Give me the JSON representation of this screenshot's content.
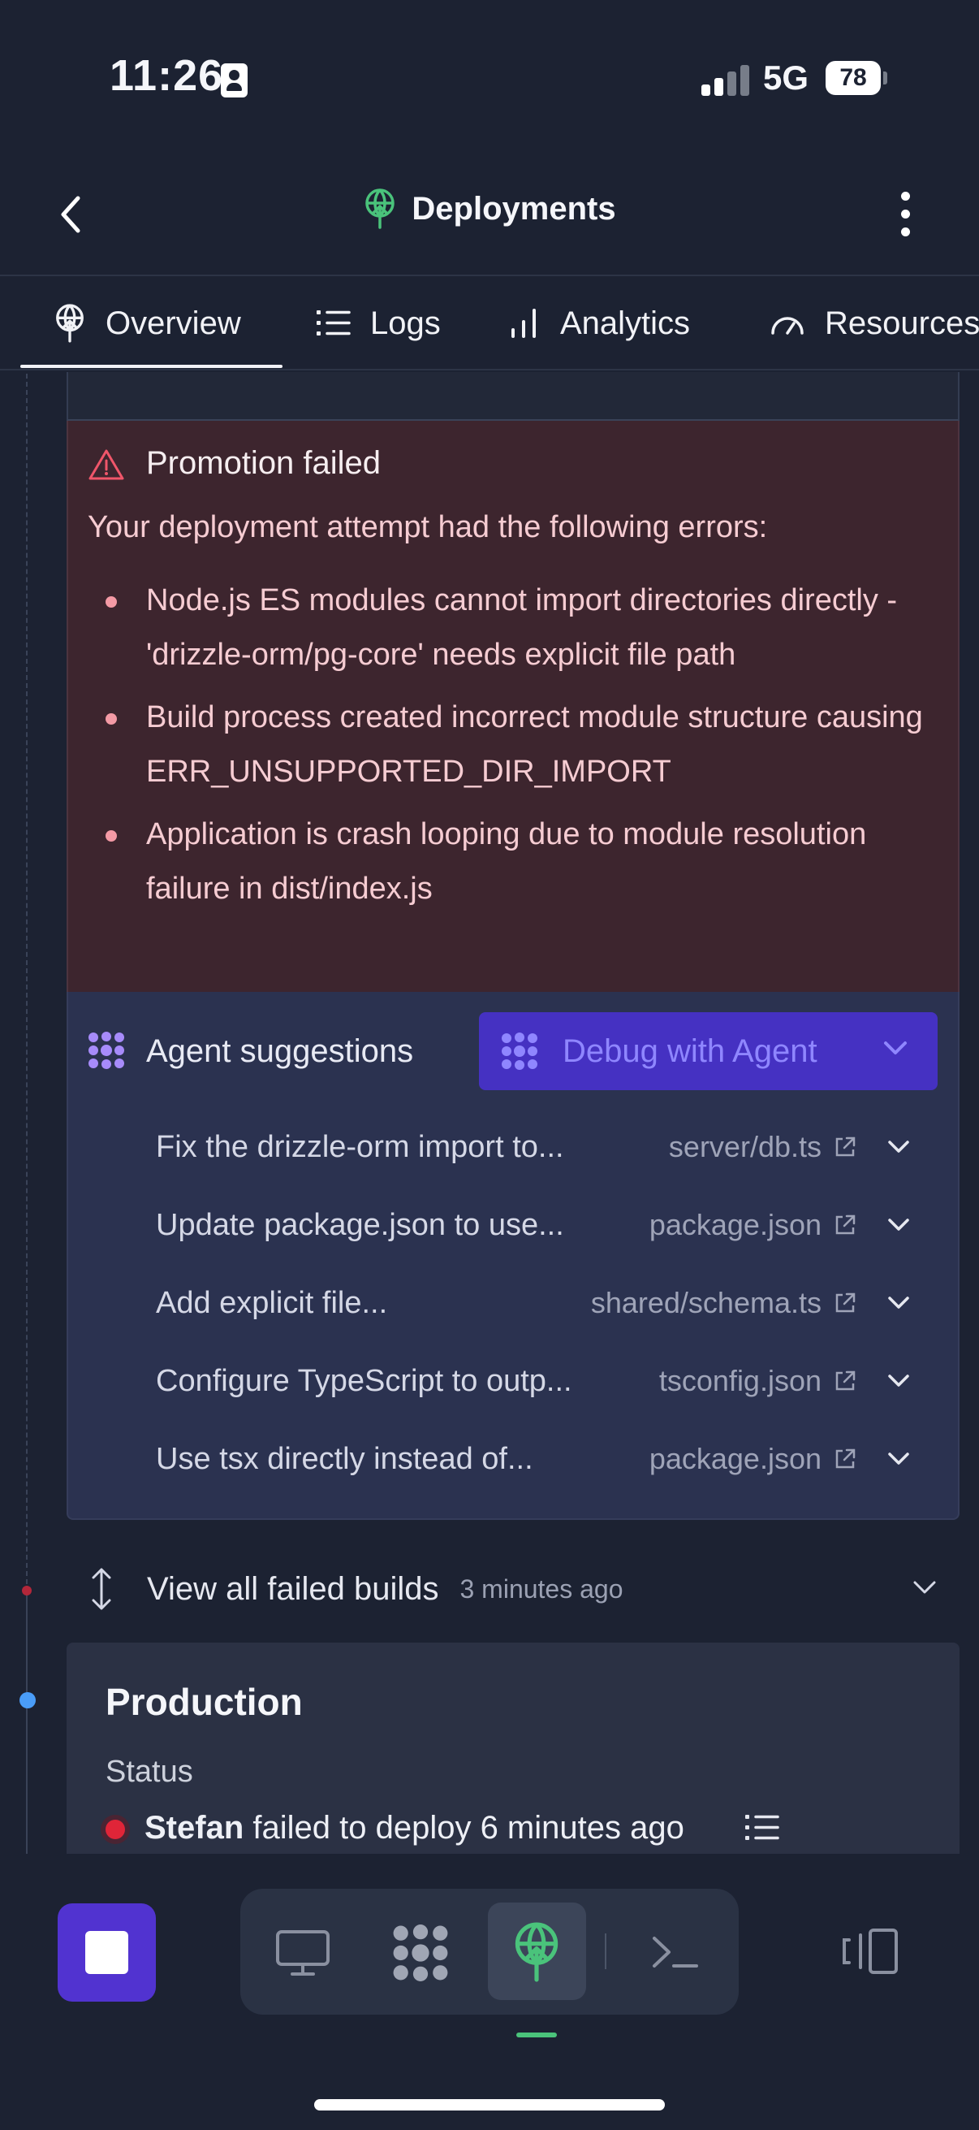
{
  "status_bar": {
    "time": "11:26",
    "network": "5G",
    "battery": "78"
  },
  "header": {
    "title": "Deployments"
  },
  "tabs": [
    {
      "label": "Overview",
      "icon": "deploy-icon",
      "active": true
    },
    {
      "label": "Logs",
      "icon": "list-icon"
    },
    {
      "label": "Analytics",
      "icon": "bar-chart-icon"
    },
    {
      "label": "Resources",
      "icon": "gauge-icon"
    }
  ],
  "error": {
    "title": "Promotion failed",
    "intro": "Your deployment attempt had the following errors:",
    "items": [
      "Node.js ES modules cannot import directories directly - 'drizzle-orm/pg-core' needs explicit file path",
      "Build process created incorrect module structure causing ERR_UNSUPPORTED_DIR_IMPORT",
      "Application is crash looping due to module resolution failure in dist/index.js"
    ]
  },
  "agent": {
    "label": "Agent suggestions",
    "debug_button": "Debug with Agent",
    "suggestions": [
      {
        "text": "Fix the drizzle-orm import to...",
        "file": "server/db.ts"
      },
      {
        "text": "Update package.json to use...",
        "file": "package.json"
      },
      {
        "text": "Add explicit file...",
        "file": "shared/schema.ts"
      },
      {
        "text": "Configure TypeScript to outp...",
        "file": "tsconfig.json"
      },
      {
        "text": "Use tsx directly instead of...",
        "file": "package.json"
      }
    ]
  },
  "failed_builds": {
    "label": "View all failed builds",
    "time": "3 minutes ago"
  },
  "production": {
    "title": "Production",
    "status_label": "Status",
    "user": "Stefan",
    "status_text": "failed to deploy 6 minutes ago"
  },
  "colors": {
    "accent": "#5133d0",
    "error_bg": "#3d252e",
    "agent_bg": "#2b3250",
    "success": "#4ac37b",
    "danger": "#e02538"
  }
}
